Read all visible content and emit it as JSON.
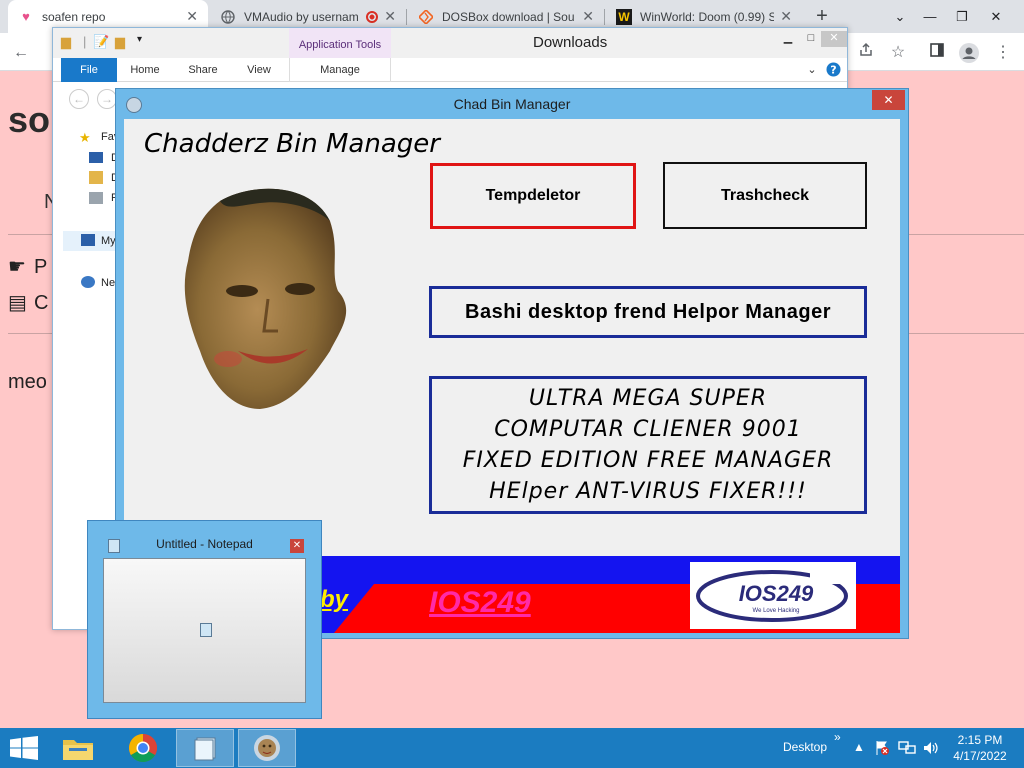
{
  "browser": {
    "tabs": [
      {
        "title": "soafen repo",
        "favicon": "heart-icon",
        "active": true
      },
      {
        "title": "VMAudio by usernam",
        "favicon": "globe-icon"
      },
      {
        "title": "DOSBox download | Sou",
        "favicon": "sourceforge-icon"
      },
      {
        "title": "WinWorld: Doom (0.99) S",
        "favicon": "winworld-icon"
      }
    ],
    "close_glyph": "✕",
    "newtab_glyph": "+"
  },
  "page": {
    "heading": "so",
    "n_letter": "N",
    "row1": "P",
    "row2": "C",
    "meo": "meo"
  },
  "explorer": {
    "contextual_tab": "Application Tools",
    "title": "Downloads",
    "ribbon_tabs": [
      "File",
      "Home",
      "Share",
      "View",
      "Manage"
    ],
    "sidebar": [
      "Fav",
      "D",
      "D",
      "R",
      "My",
      "Ne"
    ]
  },
  "chad": {
    "title": "Chad Bin Manager",
    "close": "✕",
    "heading": "Chadderz Bin Manager",
    "btn_temp": "Tempdeletor",
    "btn_trash": "Trashcheck",
    "btn_bashi": "Bashi desktop frend Helpor Manager",
    "btn_ultra": [
      "ULTRA MEGA SUPER",
      "COMPUTAR CLIENER 9001",
      "FIXED EDITION FREE MANAGER",
      "HElper ANT-VIRUS FIXER!!!"
    ],
    "banner_by": "by",
    "banner_name": "IOS249",
    "logo_text": "IOS249",
    "logo_sub": "We Love Hacking",
    "colors": {
      "banner_blue": "#1414f0",
      "banner_red": "#ff0000",
      "by_yellow": "#ffee00",
      "name_pink": "#ff2aa8"
    }
  },
  "notepad": {
    "title": "Untitled - Notepad",
    "close": "✕"
  },
  "taskbar": {
    "desktop_label": "Desktop",
    "overflow": "»",
    "time": "2:15 PM",
    "date": "4/17/2022"
  }
}
